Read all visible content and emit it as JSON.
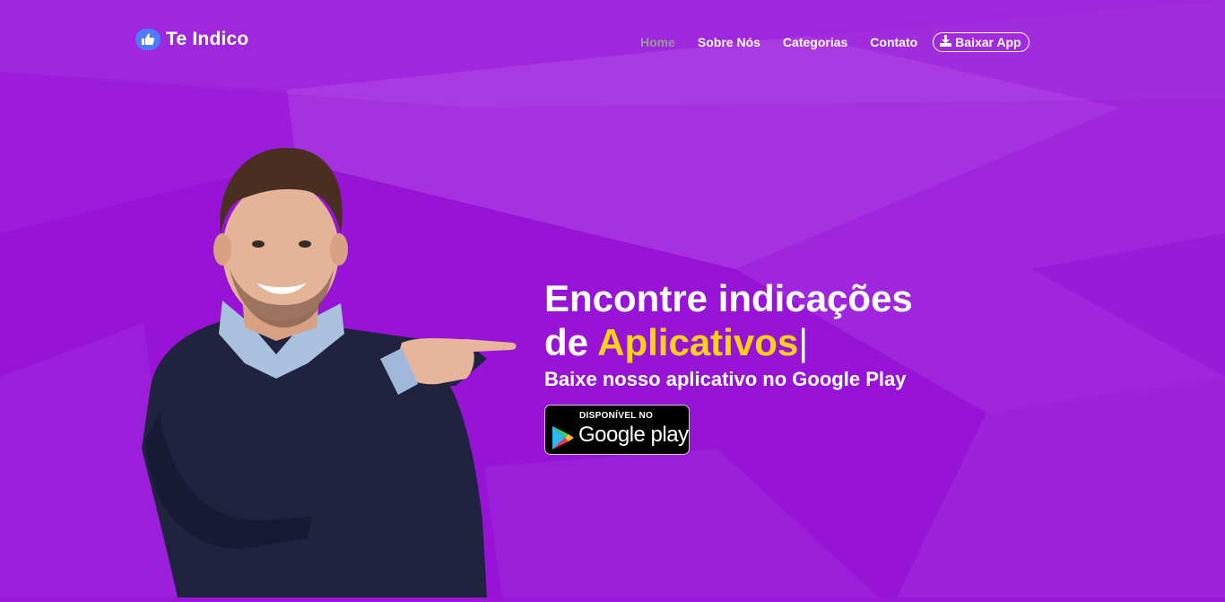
{
  "brand": {
    "name": "Te Indico",
    "icon": "thumbs-up-icon",
    "icon_color": "#4f7bff"
  },
  "nav": {
    "items": [
      {
        "label": "Home",
        "active": true
      },
      {
        "label": "Sobre Nós",
        "active": false
      },
      {
        "label": "Categorias",
        "active": false
      },
      {
        "label": "Contato",
        "active": false
      }
    ],
    "download": {
      "label": "Baixar App",
      "icon": "download-icon"
    }
  },
  "hero": {
    "line1": "Encontre indicações",
    "line2_prefix": "de",
    "line2_accent": "Aplicativos",
    "cursor": "|",
    "subtitle": "Baixe nosso aplicativo no Google Play",
    "accent_color": "#ffd21a"
  },
  "google_play": {
    "small_text": "DISPONÍVEL NO",
    "big_text": "Google play"
  },
  "colors": {
    "background": "#9a17d9",
    "nav_active": "#9a9a9a"
  }
}
